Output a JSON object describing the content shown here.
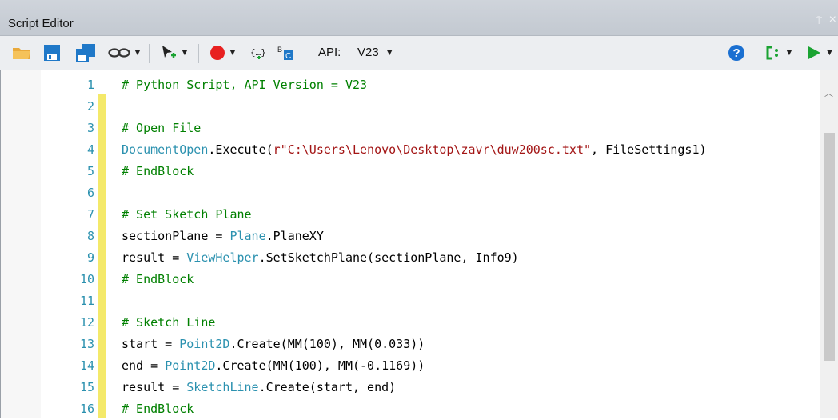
{
  "window": {
    "title": "Script Editor",
    "pin_glyph": "⍑",
    "close_glyph": "×"
  },
  "toolbar": {
    "api_label": "API:",
    "api_value": "V23",
    "buttons": [
      {
        "name": "open-folder-icon"
      },
      {
        "name": "save-icon"
      },
      {
        "name": "save-as-icon"
      },
      {
        "name": "link-icon"
      },
      {
        "name": "selection-tool-icon"
      },
      {
        "name": "record-icon"
      },
      {
        "name": "insert-block-icon"
      },
      {
        "name": "replace-icon"
      },
      {
        "name": "help-icon"
      },
      {
        "name": "run-options-icon"
      },
      {
        "name": "run-icon"
      }
    ],
    "colors": {
      "record": "#e82020",
      "help": "#1a6fd1",
      "run": "#1aa332",
      "save": "#1f78c8"
    }
  },
  "editor": {
    "lines": [
      {
        "n": "1",
        "segments": [
          {
            "t": "# Python Script, API Version = V23",
            "c": "comment"
          }
        ]
      },
      {
        "n": "2",
        "segments": []
      },
      {
        "n": "3",
        "segments": [
          {
            "t": "# Open File",
            "c": "comment"
          }
        ]
      },
      {
        "n": "4",
        "segments": [
          {
            "t": "DocumentOpen",
            "c": "type"
          },
          {
            "t": ".Execute(",
            "c": "plain"
          },
          {
            "t": "r\"C:\\Users\\Lenovo\\Desktop\\zavr\\duw200sc.txt\"",
            "c": "string"
          },
          {
            "t": ", FileSettings1)",
            "c": "plain"
          }
        ]
      },
      {
        "n": "5",
        "segments": [
          {
            "t": "# EndBlock",
            "c": "comment"
          }
        ]
      },
      {
        "n": "6",
        "segments": []
      },
      {
        "n": "7",
        "segments": [
          {
            "t": "# Set Sketch Plane",
            "c": "comment"
          }
        ]
      },
      {
        "n": "8",
        "segments": [
          {
            "t": "sectionPlane = ",
            "c": "plain"
          },
          {
            "t": "Plane",
            "c": "type"
          },
          {
            "t": ".PlaneXY",
            "c": "plain"
          }
        ]
      },
      {
        "n": "9",
        "segments": [
          {
            "t": "result = ",
            "c": "plain"
          },
          {
            "t": "ViewHelper",
            "c": "type"
          },
          {
            "t": ".SetSketchPlane(sectionPlane, Info9)",
            "c": "plain"
          }
        ]
      },
      {
        "n": "10",
        "segments": [
          {
            "t": "# EndBlock",
            "c": "comment"
          }
        ]
      },
      {
        "n": "11",
        "segments": []
      },
      {
        "n": "12",
        "segments": [
          {
            "t": "# Sketch Line",
            "c": "comment"
          }
        ]
      },
      {
        "n": "13",
        "segments": [
          {
            "t": "start = ",
            "c": "plain"
          },
          {
            "t": "Point2D",
            "c": "type"
          },
          {
            "t": ".Create(MM(100), MM(0.033))",
            "c": "plain"
          }
        ],
        "cursor": true
      },
      {
        "n": "14",
        "segments": [
          {
            "t": "end = ",
            "c": "plain"
          },
          {
            "t": "Point2D",
            "c": "type"
          },
          {
            "t": ".Create(MM(100), MM(-0.1169))",
            "c": "plain"
          }
        ]
      },
      {
        "n": "15",
        "segments": [
          {
            "t": "result = ",
            "c": "plain"
          },
          {
            "t": "SketchLine",
            "c": "type"
          },
          {
            "t": ".Create(start, end)",
            "c": "plain"
          }
        ]
      },
      {
        "n": "16",
        "segments": [
          {
            "t": "# EndBlock",
            "c": "comment"
          }
        ]
      }
    ]
  }
}
